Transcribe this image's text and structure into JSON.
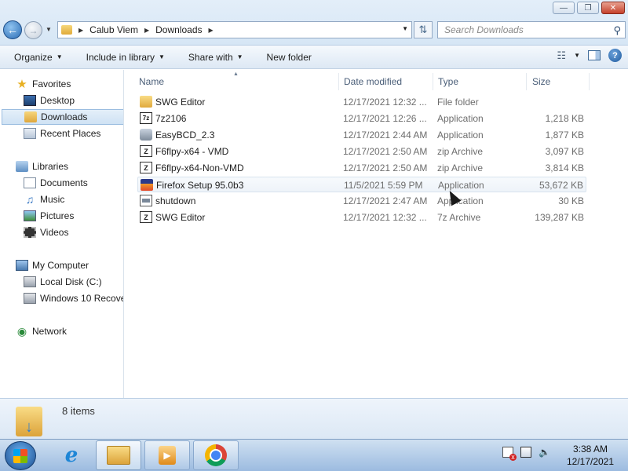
{
  "window": {
    "min_label": "—",
    "max_label": "❐",
    "close_label": "✕"
  },
  "address": {
    "crumbs": [
      "Calub Viem",
      "Downloads"
    ],
    "search_placeholder": "Search Downloads"
  },
  "toolbar": {
    "organize": "Organize",
    "include": "Include in library",
    "share": "Share with",
    "new_folder": "New folder"
  },
  "nav": {
    "favorites": "Favorites",
    "desktop": "Desktop",
    "downloads": "Downloads",
    "recent": "Recent Places",
    "libraries": "Libraries",
    "documents": "Documents",
    "music": "Music",
    "pictures": "Pictures",
    "videos": "Videos",
    "computer": "My Computer",
    "local_disk": "Local Disk (C:)",
    "recovery": "Windows 10 Recove",
    "network": "Network"
  },
  "columns": {
    "name": "Name",
    "date": "Date modified",
    "type": "Type",
    "size": "Size"
  },
  "files": [
    {
      "name": "SWG Editor",
      "date": "12/17/2021 12:32 ...",
      "type": "File folder",
      "size": "",
      "icon": "folder-icon"
    },
    {
      "name": "7z2106",
      "date": "12/17/2021 12:26 ...",
      "type": "Application",
      "size": "1,218 KB",
      "icon": "7zip-icon"
    },
    {
      "name": "EasyBCD_2.3",
      "date": "12/17/2021 2:44 AM",
      "type": "Application",
      "size": "1,877 KB",
      "icon": "easybcd-icon"
    },
    {
      "name": "F6flpy-x64 - VMD",
      "date": "12/17/2021 2:50 AM",
      "type": "zip Archive",
      "size": "3,097 KB",
      "icon": "zip-icon"
    },
    {
      "name": "F6flpy-x64-Non-VMD",
      "date": "12/17/2021 2:50 AM",
      "type": "zip Archive",
      "size": "3,814 KB",
      "icon": "zip-icon"
    },
    {
      "name": "Firefox Setup 95.0b3",
      "date": "11/5/2021 5:59 PM",
      "type": "Application",
      "size": "53,672 KB",
      "icon": "firefox-icon"
    },
    {
      "name": "shutdown",
      "date": "12/17/2021 2:47 AM",
      "type": "Application",
      "size": "30 KB",
      "icon": "application-icon"
    },
    {
      "name": "SWG Editor",
      "date": "12/17/2021 12:32 ...",
      "type": "7z Archive",
      "size": "139,287 KB",
      "icon": "archive-icon"
    }
  ],
  "details": {
    "count": "8 items"
  },
  "clock": {
    "time": "3:38 AM",
    "date": "12/17/2021"
  }
}
